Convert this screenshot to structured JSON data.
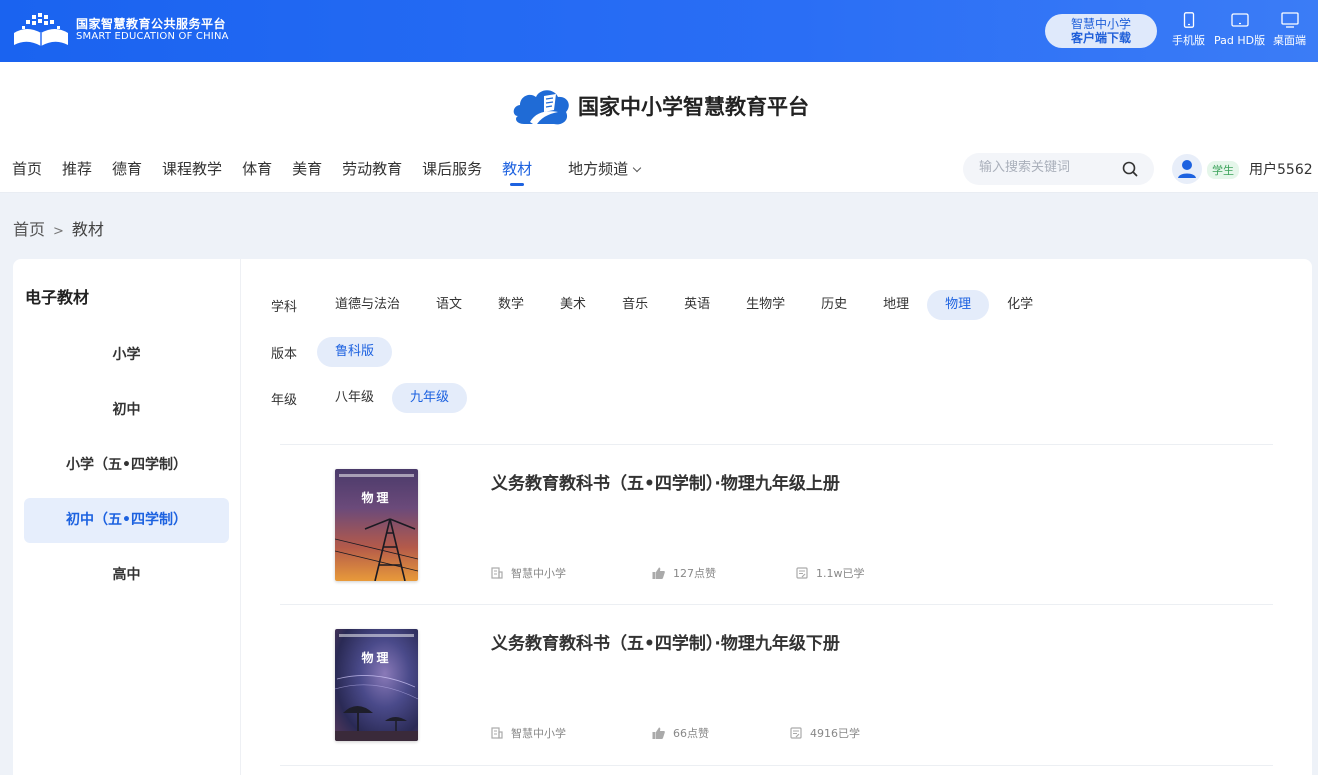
{
  "topbar": {
    "logo_cn": "国家智慧教育公共服务平台",
    "logo_en": "SMART EDUCATION OF CHINA",
    "download_line1": "智慧中小学",
    "download_line2": "客户端下载",
    "devices": [
      {
        "label": "手机版",
        "icon": "phone-icon"
      },
      {
        "label": "Pad HD版",
        "icon": "tablet-icon"
      },
      {
        "label": "桌面端",
        "icon": "desktop-icon"
      }
    ]
  },
  "header": {
    "brand_title": "国家中小学智慧教育平台",
    "nav": [
      "首页",
      "推荐",
      "德育",
      "课程教学",
      "体育",
      "美育",
      "劳动教育",
      "课后服务",
      "教材",
      "地方频道"
    ],
    "nav_active": "教材",
    "search_placeholder": "输入搜索关键词",
    "role_badge": "学生",
    "username": "用户5562"
  },
  "breadcrumb": {
    "home": "首页",
    "sep": ">",
    "current": "教材"
  },
  "sidebar": {
    "title": "电子教材",
    "items": [
      "小学",
      "初中",
      "小学（五•四学制）",
      "初中（五•四学制）",
      "高中"
    ],
    "active": "初中（五•四学制）"
  },
  "filters": {
    "subject_label": "学科",
    "subjects": [
      "道德与法治",
      "语文",
      "数学",
      "美术",
      "音乐",
      "英语",
      "生物学",
      "历史",
      "地理",
      "物理",
      "化学"
    ],
    "subject_active": "物理",
    "edition_label": "版本",
    "editions": [
      "鲁科版"
    ],
    "edition_active": "鲁科版",
    "grade_label": "年级",
    "grades": [
      "八年级",
      "九年级"
    ],
    "grade_active": "九年级"
  },
  "books": [
    {
      "title": "义务教育教科书（五•四学制）·物理九年级上册",
      "cover_title": "物理",
      "publisher": "智慧中小学",
      "likes": "127点赞",
      "learners": "1.1w已学"
    },
    {
      "title": "义务教育教科书（五•四学制）·物理九年级下册",
      "cover_title": "物理",
      "publisher": "智慧中小学",
      "likes": "66点赞",
      "learners": "4916已学"
    }
  ],
  "colors": {
    "primary": "#1d62e0",
    "topbar": "#2a6ef5",
    "page_bg": "#eef2f8"
  }
}
